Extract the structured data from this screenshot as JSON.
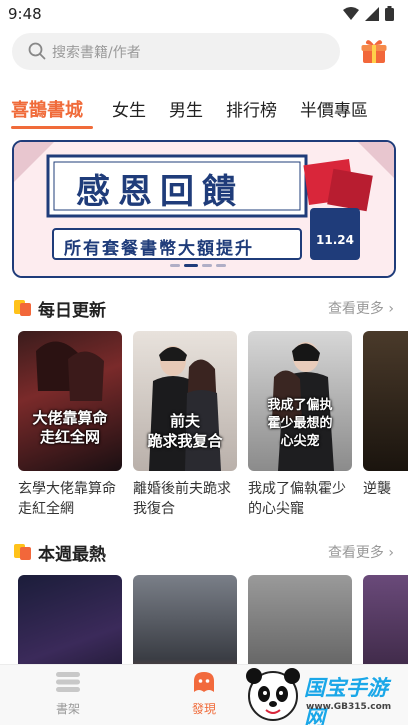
{
  "status": {
    "time": "9:48"
  },
  "search": {
    "placeholder": "搜索書籍/作者"
  },
  "tabs": [
    {
      "label": "喜鵲書城",
      "active": true
    },
    {
      "label": "女生"
    },
    {
      "label": "男生"
    },
    {
      "label": "排行榜"
    },
    {
      "label": "半價專區"
    }
  ],
  "banner": {
    "title": "感恩回饋",
    "subtitle": "所有套餐書幣大額提升",
    "date": "11.24"
  },
  "daily": {
    "title": "每日更新",
    "more": "查看更多 ›",
    "books": [
      {
        "cover_title": "大佬靠算命\n走红全网",
        "name": "玄學大佬靠算命走紅全網"
      },
      {
        "cover_title": "前夫\n跪求我复合",
        "name": "離婚後前夫跪求我復合"
      },
      {
        "cover_title": "我成了偏执\n霍少最想的\n心尖宠",
        "name": "我成了偏執霍少的心尖寵"
      },
      {
        "cover_title": "",
        "name": "逆襲"
      }
    ]
  },
  "weekly": {
    "title": "本週最熱",
    "more": "查看更多 ›"
  },
  "nav": {
    "shelf": "書架",
    "discover": "發現"
  },
  "watermark": {
    "text": "国宝手游网",
    "url": "www.GB315.com"
  },
  "colors": {
    "accent": "#f06b3a",
    "banner_blue": "#1f3c7a",
    "banner_pink": "#fdecef"
  }
}
